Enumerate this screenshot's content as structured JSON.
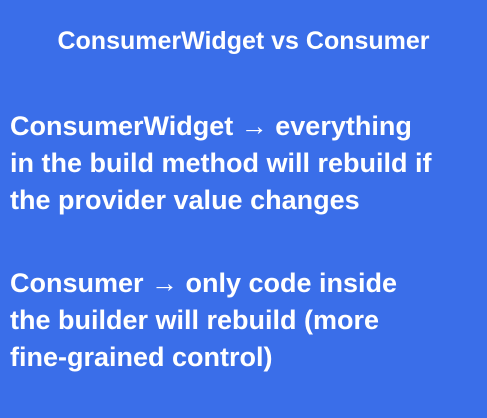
{
  "title": "ConsumerWidget vs Consumer",
  "paragraphs": [
    {
      "lines": [
        "ConsumerWidget → everything",
        "in the build method will rebuild if",
        "the provider value changes"
      ]
    },
    {
      "lines": [
        "Consumer → only code inside",
        "the builder will rebuild (more",
        "fine-grained control)"
      ]
    }
  ],
  "colors": {
    "background": "#3a6ee9",
    "text": "#ffffff"
  }
}
